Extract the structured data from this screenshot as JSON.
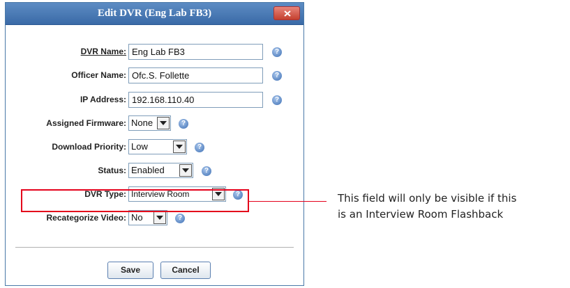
{
  "dialog": {
    "title": "Edit DVR (Eng Lab FB3)",
    "close_icon": "close-x-icon"
  },
  "fields": {
    "dvr_name": {
      "label": "DVR Name:",
      "value": "Eng Lab FB3"
    },
    "officer_name": {
      "label": "Officer Name:",
      "value": "Ofc.S. Follette"
    },
    "ip_address": {
      "label": "IP Address:",
      "value": "192.168.110.40"
    },
    "assigned_firmware": {
      "label": "Assigned Firmware:",
      "value": "None"
    },
    "download_priority": {
      "label": "Download Priority:",
      "value": "Low"
    },
    "status": {
      "label": "Status:",
      "value": "Enabled"
    },
    "dvr_type": {
      "label": "DVR Type:",
      "value": "Interview Room"
    },
    "recategorize_video": {
      "label": "Recategorize Video:",
      "value": "No"
    }
  },
  "help_glyph": "?",
  "buttons": {
    "save": "Save",
    "cancel": "Cancel"
  },
  "annotation": {
    "line1": "This field will only be visible if this",
    "line2": "is an Interview Room Flashback",
    "highlight_color": "#e4001b"
  },
  "colors": {
    "titlebar": "#4a7bb7",
    "help_icon": "#3d6fb4"
  }
}
